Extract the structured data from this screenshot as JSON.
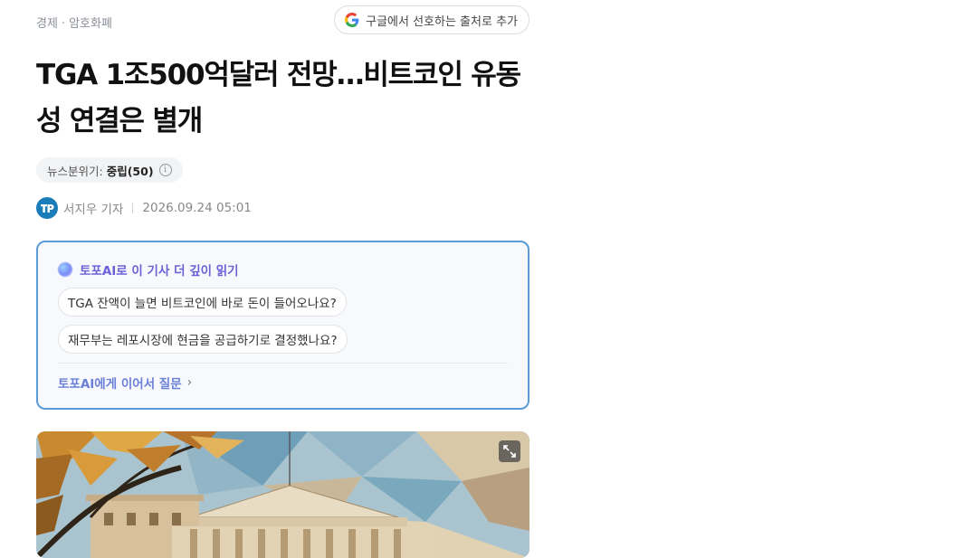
{
  "breadcrumb": {
    "section": "경제",
    "separator": "·",
    "subsection": "암호화폐"
  },
  "google_button": {
    "label": "구글에서 선호하는 출처로 추가"
  },
  "headline": "TGA 1조500억달러 전망…비트코인 유동성 연결은 별개",
  "sentiment": {
    "label": "뉴스분위기:",
    "value": "중립(50)",
    "info_icon": "info-icon"
  },
  "byline": {
    "reporter": "서지우 기자",
    "datetime": "2026.09.24 05:01"
  },
  "ai_panel": {
    "title": "토포AI로 이 기사 더 깊이 읽기",
    "questions": [
      "TGA 잔액이 늘면 비트코인에 바로 돈이 들어오나요?",
      "재무부는 레포시장에 현금을 공급하기로 결정했나요?"
    ],
    "follow_up": "토포AI에게 이어서 질문",
    "chevron": "›"
  },
  "colors": {
    "accent_border": "#5b9bd8",
    "ai_title": "#6b62d8",
    "ai_link": "#6a7fd8",
    "avatar": "#1a7cb8"
  },
  "icons": {
    "google": "google-g-icon",
    "expand": "expand-icon",
    "ai": "ai-logo-icon",
    "avatar": "reporter-avatar"
  }
}
